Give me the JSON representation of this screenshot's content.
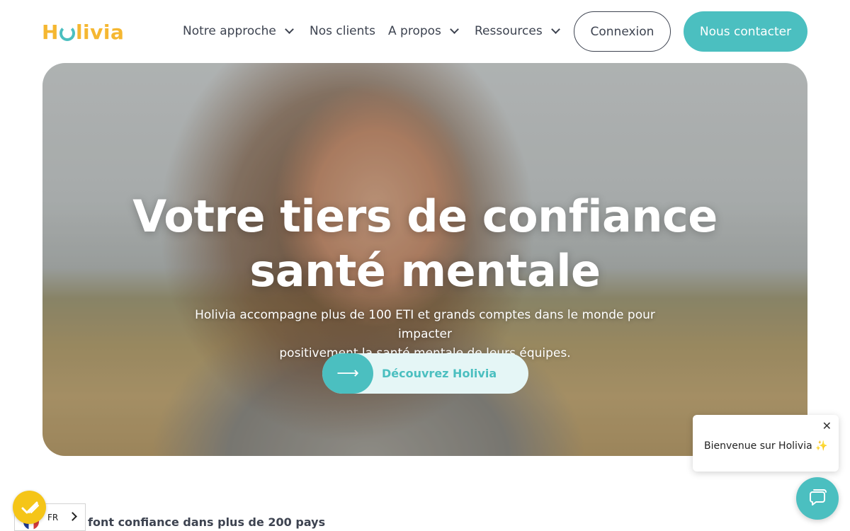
{
  "header": {
    "logo_text_left": "H",
    "logo_text_right": "livia",
    "nav": [
      {
        "label": "Notre approche",
        "has_dropdown": true
      },
      {
        "label": "Nos clients",
        "has_dropdown": false
      },
      {
        "label": "A propos",
        "has_dropdown": true
      },
      {
        "label": "Ressources",
        "has_dropdown": true
      }
    ],
    "login_label": "Connexion",
    "contact_label": "Nous contacter"
  },
  "hero": {
    "title_line1": "Votre tiers de confiance",
    "title_line2": "santé mentale",
    "subtitle_line1": "Holivia accompagne plus de 100 ETI et grands comptes dans le monde pour impacter",
    "subtitle_line2": "positivement la santé mentale de leurs équipes.",
    "cta_arrow": "⟶",
    "cta_label": "Découvrez Holivia"
  },
  "chat": {
    "close_symbol": "✕",
    "greeting": "Bienvenue sur Holivia ✨"
  },
  "trust": {
    "text": "font confiance dans plus de 200 pays"
  },
  "language": {
    "current": "FR"
  },
  "colors": {
    "accent": "#4bbfc0",
    "logo": "#f5b731",
    "text": "#3d4350",
    "accessibility": "#f5c518"
  }
}
